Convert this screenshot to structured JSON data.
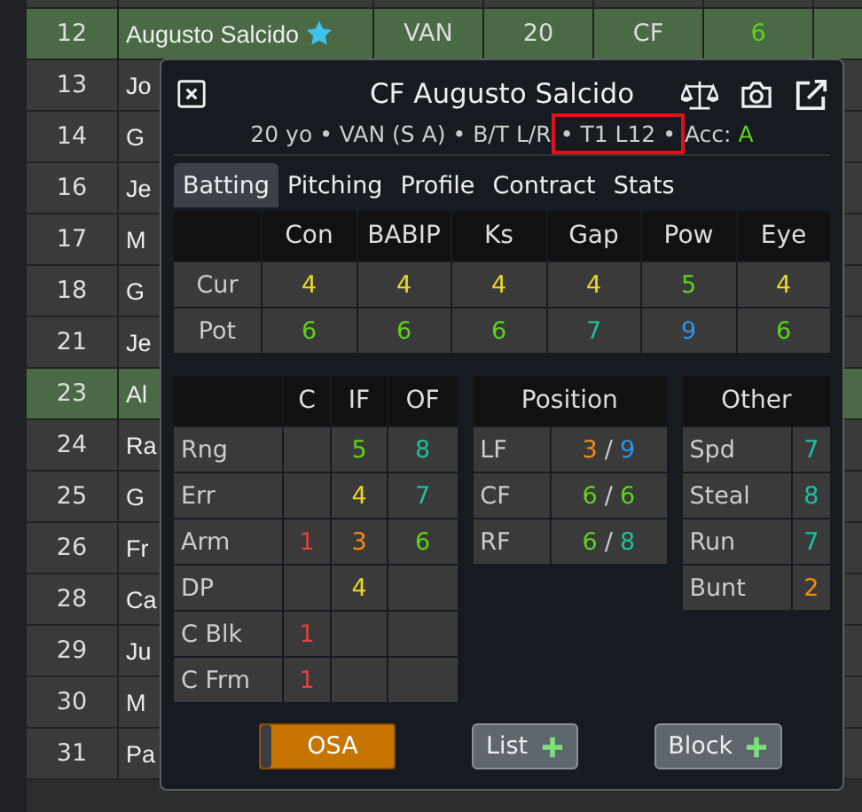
{
  "table": {
    "rows": [
      {
        "num": "12",
        "name": "Augusto Salcido",
        "favorite": true,
        "selected": true,
        "cells": [
          {
            "text": "VAN"
          },
          {
            "text": "20"
          },
          {
            "text": "CF"
          },
          {
            "text": "6",
            "color": "#5cd41a"
          }
        ]
      },
      {
        "num": "13",
        "name": "Jo",
        "selected": false
      },
      {
        "num": "14",
        "name": "G",
        "selected": false
      },
      {
        "num": "16",
        "name": "Je",
        "selected": false
      },
      {
        "num": "17",
        "name": "M",
        "selected": false
      },
      {
        "num": "18",
        "name": "G",
        "selected": false
      },
      {
        "num": "21",
        "name": "Je",
        "selected": false
      },
      {
        "num": "23",
        "name": "Al",
        "selected": true
      },
      {
        "num": "24",
        "name": "Ra",
        "selected": false
      },
      {
        "num": "25",
        "name": "G",
        "selected": false
      },
      {
        "num": "26",
        "name": "Fr",
        "selected": false
      },
      {
        "num": "28",
        "name": "Ca",
        "selected": false
      },
      {
        "num": "29",
        "name": "Ju",
        "selected": false
      },
      {
        "num": "30",
        "name": "M",
        "selected": false
      },
      {
        "num": "31",
        "name": "Pa",
        "selected": false
      }
    ]
  },
  "popup": {
    "title": "CF Augusto Salcido",
    "subtitle": {
      "info": "20 yo • VAN (S A) • B/T L/R",
      "highlight": "• T1 L12 •",
      "accuracy": {
        "label": "Acc:",
        "value": "A",
        "color": "#5cd41a"
      }
    },
    "tabs": [
      {
        "label": "Batting",
        "selected": true
      },
      {
        "label": "Pitching",
        "selected": false
      },
      {
        "label": "Profile",
        "selected": false
      },
      {
        "label": "Contract",
        "selected": false
      },
      {
        "label": "Stats",
        "selected": false
      }
    ],
    "batting": {
      "columns": [
        "Con",
        "BABIP",
        "Ks",
        "Gap",
        "Pow",
        "Eye"
      ],
      "rows": [
        {
          "label": "Cur",
          "values": [
            {
              "v": "4",
              "color": "#e8d82a"
            },
            {
              "v": "4",
              "color": "#e8d82a"
            },
            {
              "v": "4",
              "color": "#e8d82a"
            },
            {
              "v": "4",
              "color": "#e8d82a"
            },
            {
              "v": "5",
              "color": "#5cd41a"
            },
            {
              "v": "4",
              "color": "#e8d82a"
            }
          ]
        },
        {
          "label": "Pot",
          "values": [
            {
              "v": "6",
              "color": "#5cd41a"
            },
            {
              "v": "6",
              "color": "#5cd41a"
            },
            {
              "v": "6",
              "color": "#5cd41a"
            },
            {
              "v": "7",
              "color": "#1fbf9a"
            },
            {
              "v": "9",
              "color": "#2a96f0"
            },
            {
              "v": "6",
              "color": "#5cd41a"
            }
          ]
        }
      ]
    },
    "fielding": {
      "columns": [
        "C",
        "IF",
        "OF"
      ],
      "rows": [
        {
          "label": "Rng",
          "if": {
            "v": "5",
            "color": "#5cd41a"
          },
          "of": {
            "v": "8",
            "color": "#1fbf9a"
          }
        },
        {
          "label": "Err",
          "if": {
            "v": "4",
            "color": "#e8d82a"
          },
          "of": {
            "v": "7",
            "color": "#1fbf9a"
          }
        },
        {
          "label": "Arm",
          "c": {
            "v": "1",
            "color": "#d9463e"
          },
          "if": {
            "v": "3",
            "color": "#f08c10"
          },
          "of": {
            "v": "6",
            "color": "#5cd41a"
          }
        },
        {
          "label": "DP",
          "if": {
            "v": "4",
            "color": "#e8d82a"
          }
        },
        {
          "label": "C Blk",
          "c": {
            "v": "1",
            "color": "#d9463e"
          }
        },
        {
          "label": "C Frm",
          "c": {
            "v": "1",
            "color": "#d9463e"
          }
        }
      ]
    },
    "position": {
      "title": "Position",
      "rows": [
        {
          "label": "LF",
          "a": {
            "v": "3",
            "color": "#f08c10"
          },
          "sep": "/",
          "b": {
            "v": "9",
            "color": "#2a96f0"
          }
        },
        {
          "label": "CF",
          "a": {
            "v": "6",
            "color": "#5cd41a"
          },
          "sep": "/",
          "b": {
            "v": "6",
            "color": "#5cd41a"
          }
        },
        {
          "label": "RF",
          "a": {
            "v": "6",
            "color": "#5cd41a"
          },
          "sep": "/",
          "b": {
            "v": "8",
            "color": "#1fbf9a"
          }
        }
      ]
    },
    "other": {
      "title": "Other",
      "rows": [
        {
          "label": "Spd",
          "v": "7",
          "color": "#1fbf9a"
        },
        {
          "label": "Steal",
          "v": "8",
          "color": "#1fbf9a"
        },
        {
          "label": "Run",
          "v": "7",
          "color": "#1fbf9a"
        },
        {
          "label": "Bunt",
          "v": "2",
          "color": "#f08c10"
        }
      ]
    },
    "osa": {
      "label": "OSA",
      "on": true
    },
    "buttons": [
      "List",
      "Block"
    ]
  }
}
